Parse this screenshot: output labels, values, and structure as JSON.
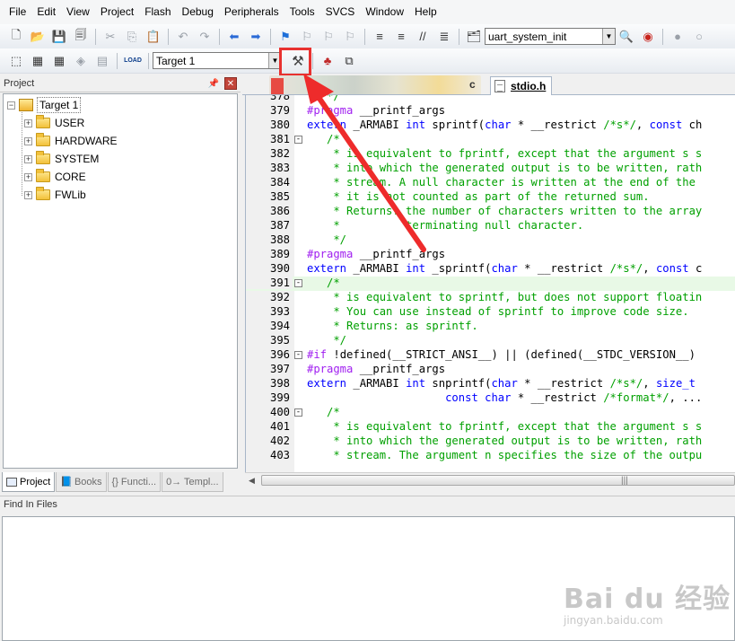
{
  "menu": [
    "File",
    "Edit",
    "View",
    "Project",
    "Flash",
    "Debug",
    "Peripherals",
    "Tools",
    "SVCS",
    "Window",
    "Help"
  ],
  "toolbar": {
    "function_combo": "uart_system_init",
    "target_combo": "Target 1",
    "load_label": "LOAD"
  },
  "project_panel": {
    "title": "Project",
    "root": "Target 1",
    "groups": [
      "USER",
      "HARDWARE",
      "SYSTEM",
      "CORE",
      "FWLib"
    ]
  },
  "left_tabs": [
    "Project",
    "Books",
    "{} Functi...",
    "0→ Templ..."
  ],
  "editor": {
    "partial_tab_suffix": "c",
    "active_tab": "stdio.h",
    "lines": [
      {
        "n": "378",
        "t": "   */"
      },
      {
        "n": "379",
        "t": "#pragma __printf_args"
      },
      {
        "n": "380",
        "t": "extern _ARMABI int sprintf(char * __restrict /*s*/, const ch"
      },
      {
        "n": "381",
        "t": "   /*",
        "fold": "-"
      },
      {
        "n": "382",
        "t": "    * is equivalent to fprintf, except that the argument s s"
      },
      {
        "n": "383",
        "t": "    * into which the generated output is to be written, rath"
      },
      {
        "n": "384",
        "t": "    * stream. A null character is written at the end of the"
      },
      {
        "n": "385",
        "t": "    * it is not counted as part of the returned sum."
      },
      {
        "n": "386",
        "t": "    * Returns: the number of characters written to the array"
      },
      {
        "n": "387",
        "t": "    *          terminating null character."
      },
      {
        "n": "388",
        "t": "    */"
      },
      {
        "n": "389",
        "t": "#pragma __printf_args"
      },
      {
        "n": "390",
        "t": "extern _ARMABI int _sprintf(char * __restrict /*s*/, const c"
      },
      {
        "n": "391",
        "t": "   /*",
        "fold": "-"
      },
      {
        "n": "392",
        "t": "    * is equivalent to sprintf, but does not support floatin"
      },
      {
        "n": "393",
        "t": "    * You can use instead of sprintf to improve code size."
      },
      {
        "n": "394",
        "t": "    * Returns: as sprintf."
      },
      {
        "n": "395",
        "t": "    */"
      },
      {
        "n": "396",
        "t": "#if !defined(__STRICT_ANSI__) || (defined(__STDC_VERSION__)",
        "fold": "-"
      },
      {
        "n": "397",
        "t": "#pragma __printf_args"
      },
      {
        "n": "398",
        "t": "extern _ARMABI int snprintf(char * __restrict /*s*/, size_t"
      },
      {
        "n": "399",
        "t": "                     const char * __restrict /*format*/, ..."
      },
      {
        "n": "400",
        "t": "   /*",
        "fold": "-"
      },
      {
        "n": "401",
        "t": "    * is equivalent to fprintf, except that the argument s s"
      },
      {
        "n": "402",
        "t": "    * into which the generated output is to be written, rath"
      },
      {
        "n": "403",
        "t": "    * stream. The argument n specifies the size of the outpu"
      }
    ]
  },
  "find_panel": {
    "title": "Find In Files"
  },
  "watermark": {
    "main": "Bai du 经验",
    "sub": "jingyan.baidu.com"
  },
  "colors": {
    "highlight": "#e8312f",
    "keyword": "#0000ff",
    "preprocessor": "#a020f0",
    "comment": "#00a000"
  }
}
